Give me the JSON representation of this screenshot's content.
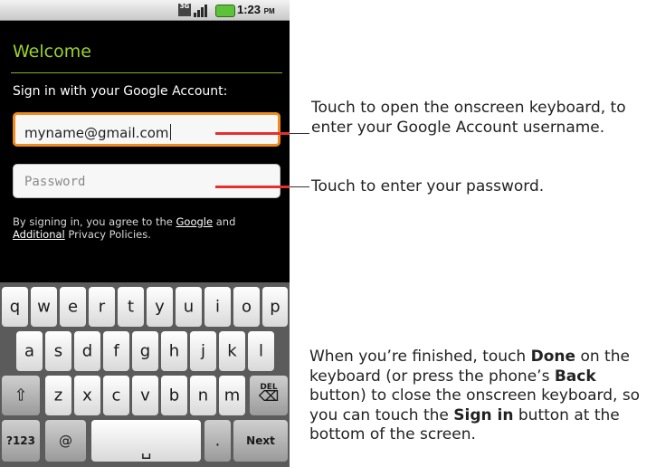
{
  "status_bar": {
    "network": "3G",
    "time": "1:23",
    "ampm": "PM"
  },
  "screen": {
    "title": "Welcome",
    "signin_label": "Sign in with your Google Account:",
    "username_value": "myname@gmail.com",
    "password_placeholder": "Password",
    "terms_prefix": "By signing in, you agree to the ",
    "terms_google": "Google",
    "terms_mid": " and",
    "terms_additional": "Additional",
    "terms_suffix": " Privacy Policies."
  },
  "keyboard": {
    "row1": [
      "q",
      "w",
      "e",
      "r",
      "t",
      "y",
      "u",
      "i",
      "o",
      "p"
    ],
    "row2": [
      "a",
      "s",
      "d",
      "f",
      "g",
      "h",
      "j",
      "k",
      "l"
    ],
    "row3": [
      "z",
      "x",
      "c",
      "v",
      "b",
      "n",
      "m"
    ],
    "shift": "⇧",
    "del_label": "DEL",
    "num": "?123",
    "at": "@",
    "space": "␣",
    "dot": ".",
    "next": "Next"
  },
  "callouts": {
    "username": "Touch to open the onscreen keyboard, to enter your Google Account username.",
    "password": "Touch to enter your password.",
    "done_1": "When you’re finished, touch ",
    "done_b1": "Done",
    "done_2": " on the keyboard (or press the phone’s ",
    "done_b2": "Back",
    "done_3": " button) to close the onscreen keyboard, so you can touch the ",
    "done_b3": "Sign in",
    "done_4": " button at the bottom of the screen."
  },
  "colors": {
    "accent_green": "#9bd32a",
    "focus_orange": "#f08a1e",
    "pointer_red": "#e53030"
  }
}
